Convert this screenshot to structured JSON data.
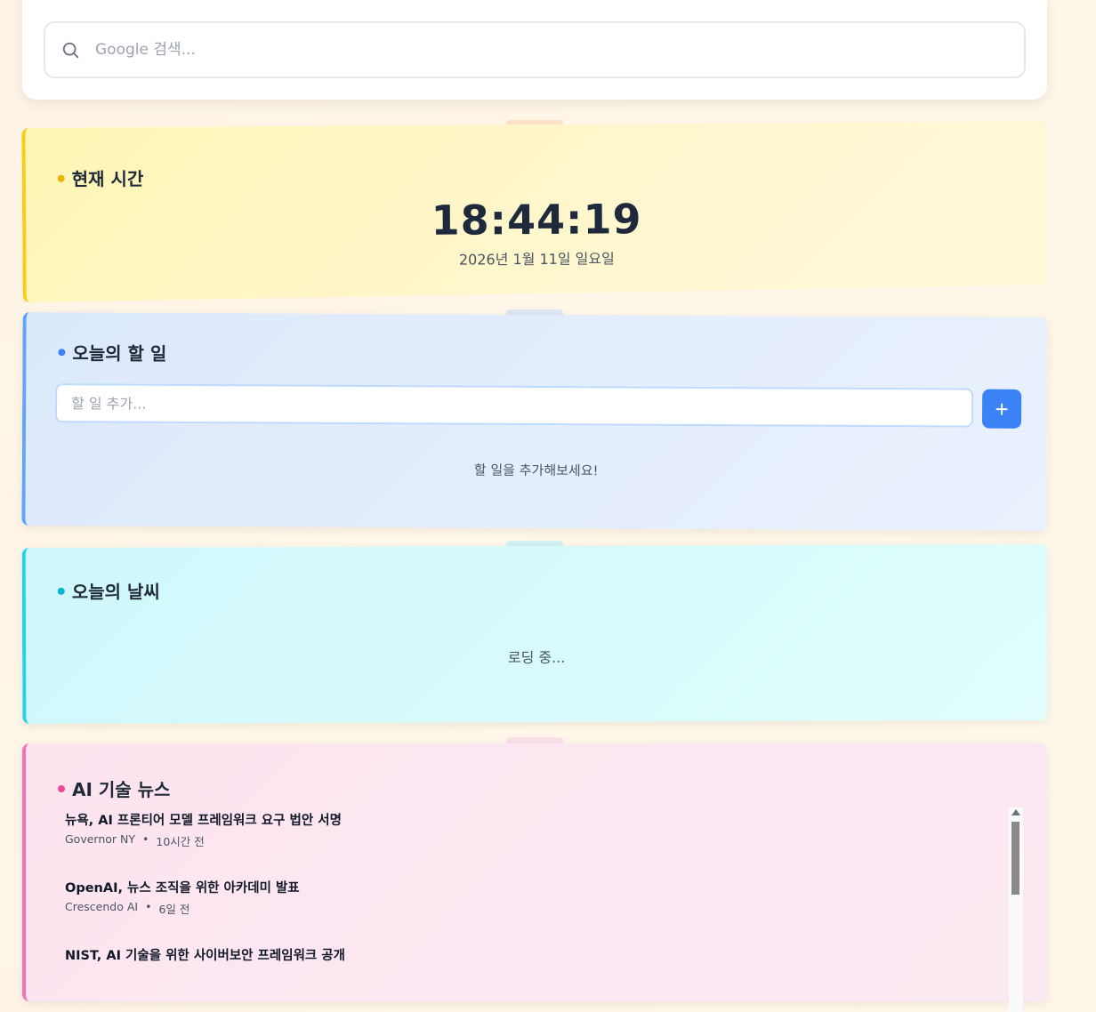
{
  "search": {
    "placeholder": "Google 검색..."
  },
  "clock": {
    "title": "현재 시간",
    "time": "18:44:19",
    "date": "2026년 1월 11일 일요일"
  },
  "todo": {
    "title": "오늘의 할 일",
    "input_placeholder": "할 일 추가...",
    "add_label": "+",
    "empty_message": "할 일을 추가해보세요!"
  },
  "weather": {
    "title": "오늘의 날씨",
    "loading": "로딩 중..."
  },
  "news": {
    "title": "AI 기술 뉴스",
    "items": [
      {
        "title": "뉴욕, AI 프론티어 모델 프레임워크 요구 법안 서명",
        "source": "Governor NY",
        "separator": "•",
        "time": "10시간 전"
      },
      {
        "title": "OpenAI, 뉴스 조직을 위한 아카데미 발표",
        "source": "Crescendo AI",
        "separator": "•",
        "time": "6일 전"
      },
      {
        "title": "NIST, AI 기술을 위한 사이버보안 프레임워크 공개",
        "source": "",
        "separator": "",
        "time": ""
      }
    ]
  },
  "colors": {
    "clock_accent": "#facc15",
    "todo_accent": "#3b82f6",
    "weather_accent": "#06b6d4",
    "news_accent": "#ec4899"
  }
}
